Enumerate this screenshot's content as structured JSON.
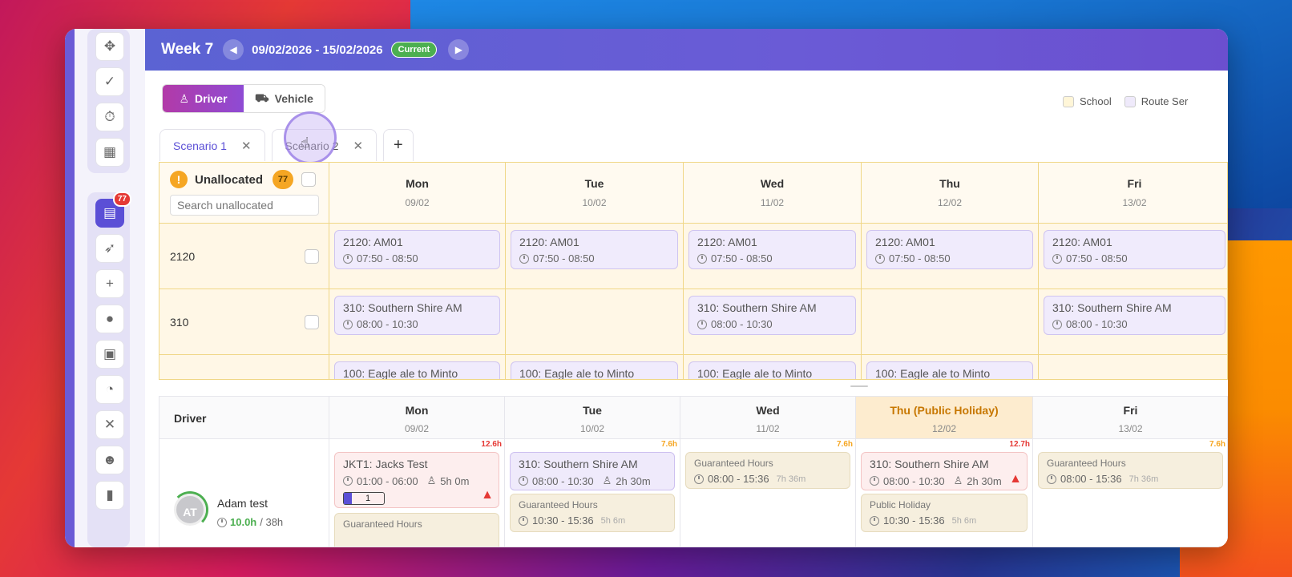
{
  "header": {
    "week_title": "Week 7",
    "date_range": "09/02/2026 - 15/02/2026",
    "current_label": "Current",
    "prev_icon": "chevron-left-icon",
    "next_icon": "chevron-right-icon",
    "gradient_color": "#6a5bd6"
  },
  "rail": {
    "badge_count": "77",
    "icons": [
      "move-icon",
      "check-icon",
      "stopwatch-icon",
      "grid-icon",
      "clipboard-icon",
      "rocket-icon",
      "plus-icon",
      "person-icon",
      "bus-icon",
      "timer-icon",
      "close-icon",
      "user-settings-icon",
      "document-icon"
    ]
  },
  "toggle": {
    "driver_label": "Driver",
    "vehicle_label": "Vehicle",
    "active_color": "#b23aa8"
  },
  "legend": {
    "items": [
      {
        "label": "School",
        "color": "#fff6d8"
      },
      {
        "label": "Route Ser",
        "color": "#efeafb"
      }
    ]
  },
  "tabs": {
    "items": [
      {
        "label": "Scenario 1"
      },
      {
        "label": "Scenario 2"
      }
    ],
    "add_label": "+"
  },
  "unallocated": {
    "title": "Unallocated",
    "count": "77",
    "search_placeholder": "Search unallocated",
    "days": [
      {
        "name": "Mon",
        "date": "09/02"
      },
      {
        "name": "Tue",
        "date": "10/02"
      },
      {
        "name": "Wed",
        "date": "11/02"
      },
      {
        "name": "Thu",
        "date": "12/02"
      },
      {
        "name": "Fri",
        "date": "13/02"
      }
    ],
    "rows": [
      {
        "label": "2120",
        "cells": [
          {
            "title": "2120: AM01",
            "time": "07:50 - 08:50"
          },
          {
            "title": "2120: AM01",
            "time": "07:50 - 08:50"
          },
          {
            "title": "2120: AM01",
            "time": "07:50 - 08:50"
          },
          {
            "title": "2120: AM01",
            "time": "07:50 - 08:50"
          },
          {
            "title": "2120: AM01",
            "time": "07:50 - 08:50"
          }
        ]
      },
      {
        "label": "310",
        "cells": [
          {
            "title": "310: Southern Shire AM",
            "time": "08:00 - 10:30"
          },
          null,
          {
            "title": "310: Southern Shire AM",
            "time": "08:00 - 10:30"
          },
          null,
          {
            "title": "310: Southern Shire AM",
            "time": "08:00 - 10:30"
          }
        ]
      },
      {
        "label": "",
        "cells": [
          {
            "title": "100: Eagle ale to Minto",
            "time": ""
          },
          {
            "title": "100: Eagle ale to Minto",
            "time": ""
          },
          {
            "title": "100: Eagle ale to Minto",
            "time": ""
          },
          {
            "title": "100: Eagle ale to Minto",
            "time": ""
          },
          null
        ]
      }
    ]
  },
  "drivers": {
    "column_label": "Driver",
    "days": [
      {
        "name": "Mon",
        "date": "09/02",
        "holiday": false
      },
      {
        "name": "Tue",
        "date": "10/02",
        "holiday": false
      },
      {
        "name": "Wed",
        "date": "11/02",
        "holiday": false
      },
      {
        "name": "Thu (Public Holiday)",
        "date": "12/02",
        "holiday": true
      },
      {
        "name": "Fri",
        "date": "13/02",
        "holiday": false
      }
    ],
    "row": {
      "avatar_initials": "AT",
      "name": "Adam test",
      "hours_used": "10.0h",
      "hours_total": "/ 38h",
      "cells": [
        {
          "hours": "12.6h",
          "hours_color": "#e53935",
          "main": {
            "title": "JKT1: Jacks Test",
            "time": "01:00 - 06:00",
            "duration": "5h 0m",
            "progress": "1"
          },
          "extra": {
            "title": "Guaranteed Hours"
          }
        },
        {
          "hours": "7.6h",
          "hours_color": "#f5a623",
          "main": {
            "title": "310: Southern Shire AM",
            "time": "08:00 - 10:30",
            "duration": "2h 30m"
          },
          "extra": {
            "title": "Guaranteed Hours",
            "time": "10:30 - 15:36",
            "duration": "5h 6m"
          }
        },
        {
          "hours": "7.6h",
          "hours_color": "#f5a623",
          "main": {
            "title": "Guaranteed Hours",
            "time": "08:00 - 15:36",
            "duration": "7h 36m"
          }
        },
        {
          "hours": "12.7h",
          "hours_color": "#e53935",
          "main": {
            "title": "310: Southern Shire AM",
            "time": "08:00 - 10:30",
            "duration": "2h 30m"
          },
          "extra": {
            "title": "Public Holiday",
            "time": "10:30 - 15:36",
            "duration": "5h 6m"
          }
        },
        {
          "hours": "7.6h",
          "hours_color": "#f5a623",
          "main": {
            "title": "Guaranteed Hours",
            "time": "08:00 - 15:36",
            "duration": "7h 36m"
          }
        }
      ]
    }
  }
}
